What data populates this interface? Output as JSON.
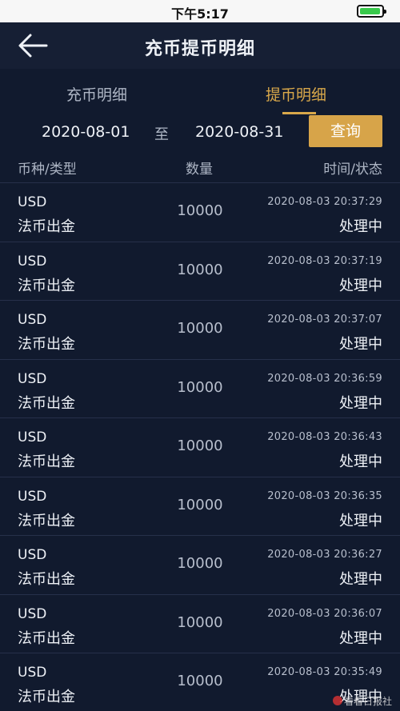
{
  "status_bar": {
    "time": "下午5:17"
  },
  "header": {
    "title": "充币提币明细"
  },
  "tabs": [
    {
      "label": "充币明细",
      "active": false
    },
    {
      "label": "提币明细",
      "active": true
    }
  ],
  "filter": {
    "start_date": "2020-08-01",
    "separator": "至",
    "end_date": "2020-08-31",
    "query_label": "查询"
  },
  "columns": {
    "currency_type": "币种/类型",
    "amount": "数量",
    "time_status": "时间/状态"
  },
  "records": [
    {
      "currency": "USD",
      "type": "法币出金",
      "amount": "10000",
      "time": "2020-08-03 20:37:29",
      "status": "处理中"
    },
    {
      "currency": "USD",
      "type": "法币出金",
      "amount": "10000",
      "time": "2020-08-03 20:37:19",
      "status": "处理中"
    },
    {
      "currency": "USD",
      "type": "法币出金",
      "amount": "10000",
      "time": "2020-08-03 20:37:07",
      "status": "处理中"
    },
    {
      "currency": "USD",
      "type": "法币出金",
      "amount": "10000",
      "time": "2020-08-03 20:36:59",
      "status": "处理中"
    },
    {
      "currency": "USD",
      "type": "法币出金",
      "amount": "10000",
      "time": "2020-08-03 20:36:43",
      "status": "处理中"
    },
    {
      "currency": "USD",
      "type": "法币出金",
      "amount": "10000",
      "time": "2020-08-03 20:36:35",
      "status": "处理中"
    },
    {
      "currency": "USD",
      "type": "法币出金",
      "amount": "10000",
      "time": "2020-08-03 20:36:27",
      "status": "处理中"
    },
    {
      "currency": "USD",
      "type": "法币出金",
      "amount": "10000",
      "time": "2020-08-03 20:36:07",
      "status": "处理中"
    },
    {
      "currency": "USD",
      "type": "法币出金",
      "amount": "10000",
      "time": "2020-08-03 20:35:49",
      "status": "处理中"
    }
  ],
  "watermark": {
    "text": "看看日报社"
  },
  "colors": {
    "background": "#111a2e",
    "accent": "#d7a449",
    "battery": "#38c94b"
  },
  "icons": {
    "back": "arrow-left-icon",
    "battery": "battery-icon"
  }
}
